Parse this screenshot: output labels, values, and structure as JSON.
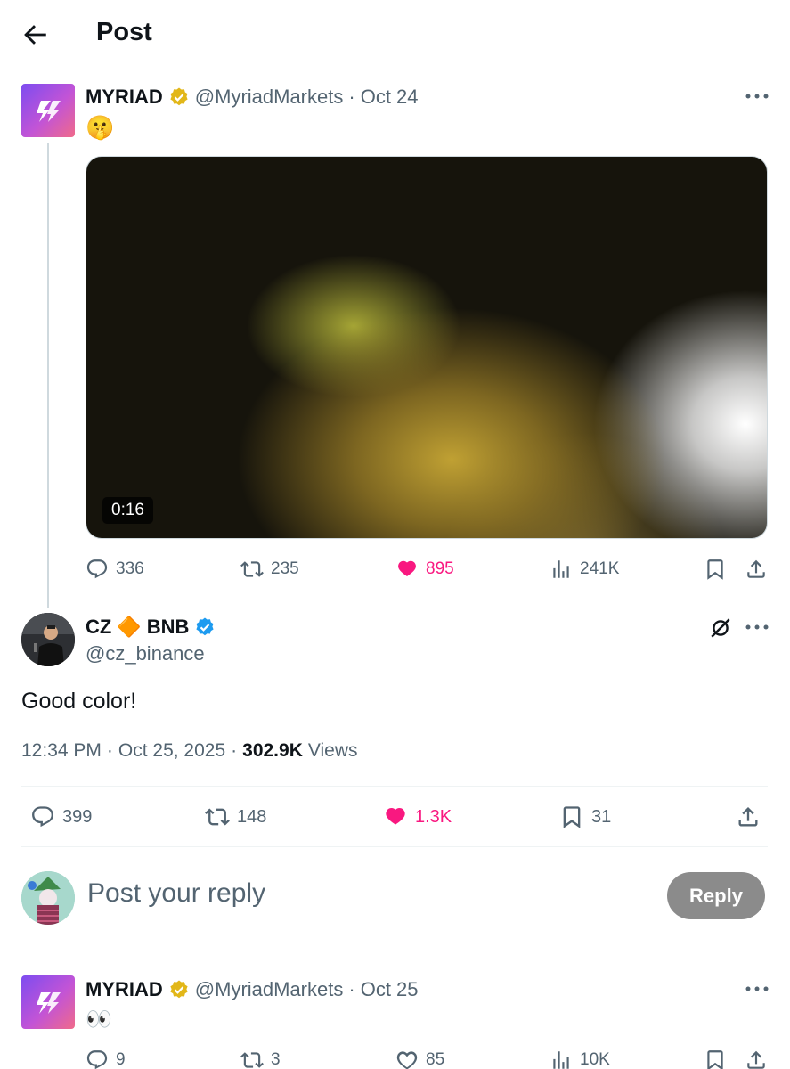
{
  "header": {
    "title": "Post"
  },
  "parent_post": {
    "name": "MYRIAD",
    "handle": "@MyriadMarkets",
    "date": "Oct 24",
    "separator": "·",
    "text": "🤫",
    "media": {
      "duration": "0:16"
    },
    "stats": {
      "replies": "336",
      "reposts": "235",
      "likes": "895",
      "views": "241K"
    }
  },
  "main_post": {
    "name": "CZ",
    "name_emoji": "🔶",
    "name_suffix": "BNB",
    "handle": "@cz_binance",
    "text": "Good color!",
    "time": "12:34 PM",
    "date": "Oct 25, 2025",
    "separator": "·",
    "views_count": "302.9K",
    "views_label": "Views",
    "stats": {
      "replies": "399",
      "reposts": "148",
      "likes": "1.3K",
      "bookmarks": "31"
    }
  },
  "reply_box": {
    "placeholder": "Post your reply",
    "button_label": "Reply"
  },
  "reply_post": {
    "name": "MYRIAD",
    "handle": "@MyriadMarkets",
    "date": "Oct 25",
    "separator": "·",
    "text": "👀",
    "stats": {
      "replies": "9",
      "reposts": "3",
      "likes": "85",
      "views": "10K"
    }
  },
  "colors": {
    "like_active": "#f91880",
    "verified_gold": "#e2b719",
    "verified_blue": "#1d9bf0",
    "secondary_text": "#536471"
  }
}
